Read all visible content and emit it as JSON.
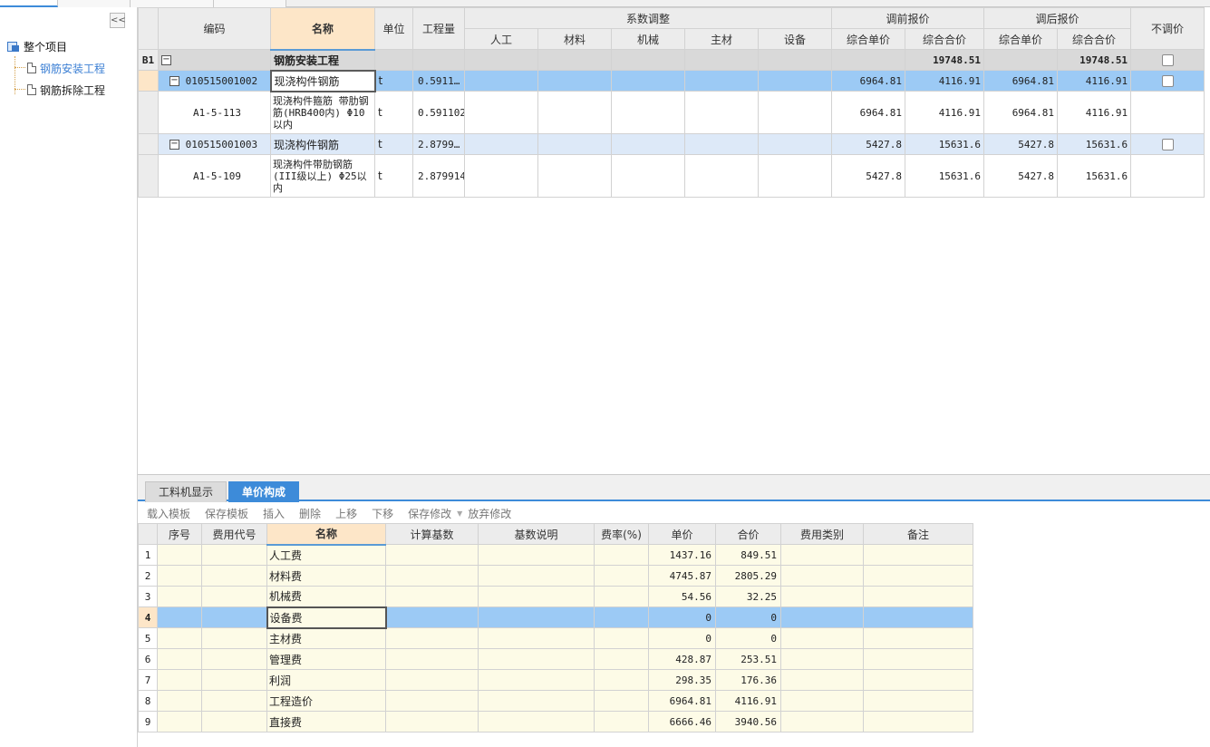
{
  "tree": {
    "root": "整个项目",
    "children": [
      "钢筋安装工程",
      "钢筋拆除工程"
    ],
    "collapse": "<<"
  },
  "main": {
    "headers": {
      "code": "编码",
      "name": "名称",
      "unit": "单位",
      "qty": "工程量",
      "coef_group": "系数调整",
      "coef": [
        "人工",
        "材料",
        "机械",
        "主材",
        "设备"
      ],
      "before_group": "调前报价",
      "after_group": "调后报价",
      "unit_price": "综合单价",
      "total_price": "综合合价",
      "no_adjust": "不调价"
    },
    "group_row": {
      "rn": "B1",
      "name": "钢筋安装工程",
      "before_total": "19748.51",
      "after_total": "19748.51"
    },
    "rows": [
      {
        "code": "010515001002",
        "name": "现浇构件钢筋",
        "unit": "t",
        "qty": "0.5911…",
        "bu": "6964.81",
        "bt": "4116.91",
        "au": "6964.81",
        "at": "4116.91"
      },
      {
        "code": "A1-5-113",
        "name": "现浇构件箍筋 带肋钢筋(HRB400内) Φ10以内",
        "unit": "t",
        "qty": "0.591102",
        "bu": "6964.81",
        "bt": "4116.91",
        "au": "6964.81",
        "at": "4116.91"
      },
      {
        "code": "010515001003",
        "name": "现浇构件钢筋",
        "unit": "t",
        "qty": "2.8799…",
        "bu": "5427.8",
        "bt": "15631.6",
        "au": "5427.8",
        "at": "15631.6"
      },
      {
        "code": "A1-5-109",
        "name": "现浇构件带肋钢筋(III级以上) Φ25以内",
        "unit": "t",
        "qty": "2.879914",
        "bu": "5427.8",
        "bt": "15631.6",
        "au": "5427.8",
        "at": "15631.6"
      }
    ]
  },
  "bottom": {
    "tabs": [
      "工料机显示",
      "单价构成"
    ],
    "toolbar": [
      "载入模板",
      "保存模板",
      "插入",
      "删除",
      "上移",
      "下移",
      "保存修改",
      "放弃修改"
    ],
    "headers": [
      "序号",
      "费用代号",
      "名称",
      "计算基数",
      "基数说明",
      "费率(%)",
      "单价",
      "合价",
      "费用类别",
      "备注"
    ],
    "rows": [
      {
        "n": "1",
        "name": "人工费",
        "price": "1437.16",
        "total": "849.51"
      },
      {
        "n": "2",
        "name": "材料费",
        "price": "4745.87",
        "total": "2805.29"
      },
      {
        "n": "3",
        "name": "机械费",
        "price": "54.56",
        "total": "32.25"
      },
      {
        "n": "4",
        "name": "设备费",
        "price": "0",
        "total": "0"
      },
      {
        "n": "5",
        "name": "主材费",
        "price": "0",
        "total": "0"
      },
      {
        "n": "6",
        "name": "管理费",
        "price": "428.87",
        "total": "253.51"
      },
      {
        "n": "7",
        "name": "利润",
        "price": "298.35",
        "total": "176.36"
      },
      {
        "n": "8",
        "name": "工程造价",
        "price": "6964.81",
        "total": "4116.91"
      },
      {
        "n": "9",
        "name": "直接费",
        "price": "6666.46",
        "total": "3940.56"
      }
    ]
  }
}
